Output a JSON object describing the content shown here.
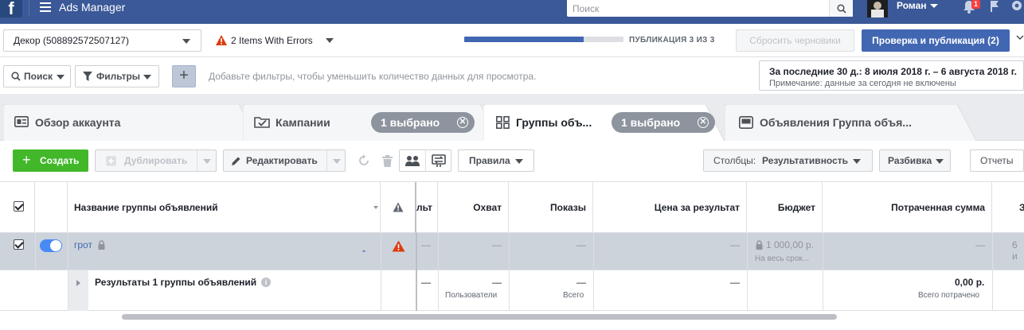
{
  "topbar": {
    "app_title": "Ads Manager",
    "search_placeholder": "Поиск",
    "user_name": "Роман",
    "notification_count": "1"
  },
  "account_bar": {
    "account": "Декор (508892572507127)",
    "errors": "2 Items With Errors",
    "publish_progress": 0.75,
    "publish_status": "ПУБЛИКАЦИЯ 3 ИЗ 3",
    "discard_label": "Сбросить черновики",
    "publish_label": "Проверка и публикация (2)"
  },
  "filter_bar": {
    "search_label": "Поиск",
    "filters_label": "Фильтры",
    "add_label": "+",
    "hint": "Добавьте фильтры, чтобы уменьшить количество данных для просмотра.",
    "date_range": "За последние 30 д.: 8 июля 2018 г. – 6 августа 2018 г.",
    "date_note": "Примечание: данные за сегодня не включены"
  },
  "tabs": [
    {
      "label": "Обзор аккаунта",
      "icon": "account-overview-icon"
    },
    {
      "label": "Кампании",
      "icon": "folder-check-icon",
      "pill": "1 выбрано"
    },
    {
      "label": "Группы объ...",
      "icon": "grid-icon",
      "pill": "1 выбрано",
      "active": true
    },
    {
      "label": "Объявления Группа объя...",
      "icon": "ad-icon"
    }
  ],
  "toolbar": {
    "create_label": "Создать",
    "duplicate_label": "Дублировать",
    "edit_label": "Редактировать",
    "rules_label": "Правила",
    "columns_prefix": "Столбцы:",
    "columns_value": "Результативность",
    "breakdown_label": "Разбивка",
    "reports_label": "Отчеты"
  },
  "table": {
    "headers": {
      "name": "Название группы объявлений",
      "results_partial": "льт",
      "reach": "Охват",
      "impressions": "Показы",
      "cost_per_result": "Цена за результат",
      "budget": "Бюджет",
      "spent": "Потраченная сумма",
      "extra_partial": "З"
    },
    "row": {
      "name": "грот",
      "placeholder": "—",
      "budget_value": "1 000,00 р.",
      "budget_note": "На весь срок...",
      "extra_partial": "6 и",
      "delivery_partial": "-"
    },
    "totals": {
      "label": "Результаты 1 группы объявлений",
      "placeholder": "—",
      "reach_sub": "Пользователи",
      "impressions_sub": "Всего",
      "spent_value": "0,00 р.",
      "spent_sub": "Всего потрачено"
    }
  }
}
